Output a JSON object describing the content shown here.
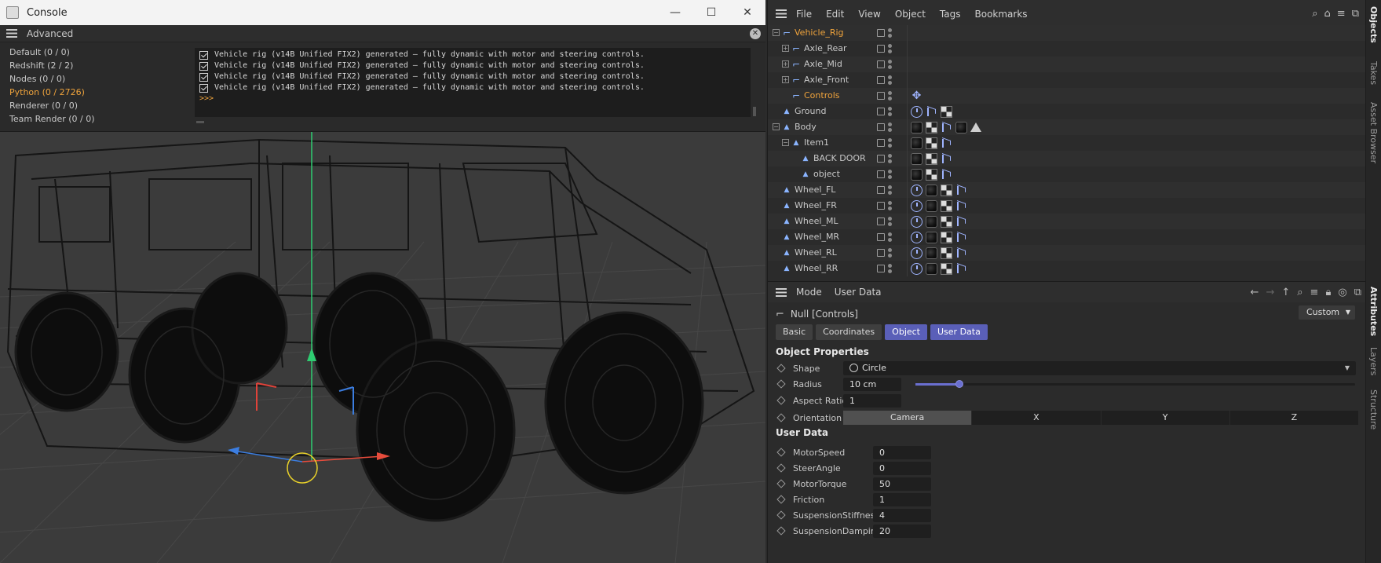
{
  "console": {
    "title": "Console",
    "window_controls": [
      "—",
      "☐",
      "✕"
    ],
    "subheader": "Advanced",
    "categories": [
      {
        "label": "Default (0 / 0)",
        "active": false
      },
      {
        "label": "Redshift (2 / 2)",
        "active": false
      },
      {
        "label": "Nodes (0 / 0)",
        "active": false
      },
      {
        "label": "Python (0 / 2726)",
        "active": true
      },
      {
        "label": "Renderer (0 / 0)",
        "active": false
      },
      {
        "label": "Team Render  (0 / 0)",
        "active": false
      }
    ],
    "lines": [
      "Vehicle rig (v14B Unified FIX2) generated — fully dynamic with motor and steering controls.",
      "Vehicle rig (v14B Unified FIX2) generated — fully dynamic with motor and steering controls.",
      "Vehicle rig (v14B Unified FIX2) generated — fully dynamic with motor and steering controls.",
      "Vehicle rig (v14B Unified FIX2) generated — fully dynamic with motor and steering controls."
    ],
    "prompt": ">>>"
  },
  "menu": {
    "items": [
      "File",
      "Edit",
      "View",
      "Object",
      "Tags",
      "Bookmarks"
    ]
  },
  "objects": [
    {
      "name": "Vehicle_Rig",
      "level": 0,
      "expander": "−",
      "icon": "null",
      "selected": true,
      "tags": []
    },
    {
      "name": "Axle_Rear",
      "level": 1,
      "expander": "+",
      "icon": "null",
      "selected": false,
      "tags": []
    },
    {
      "name": "Axle_Mid",
      "level": 1,
      "expander": "+",
      "icon": "null",
      "selected": false,
      "tags": []
    },
    {
      "name": "Axle_Front",
      "level": 1,
      "expander": "+",
      "icon": "null",
      "selected": false,
      "tags": []
    },
    {
      "name": "Controls",
      "level": 1,
      "expander": "",
      "icon": "null",
      "selected": true,
      "tags": [
        "ctl"
      ]
    },
    {
      "name": "Ground",
      "level": 0,
      "expander": "",
      "icon": "poly",
      "selected": false,
      "tags": [
        "rot",
        "uv",
        "chk"
      ]
    },
    {
      "name": "Body",
      "level": 0,
      "expander": "−",
      "icon": "poly",
      "selected": false,
      "tags": [
        "mat",
        "chk",
        "uv",
        "mat",
        "tri"
      ]
    },
    {
      "name": "Item1",
      "level": 1,
      "expander": "−",
      "icon": "poly",
      "selected": false,
      "tags": [
        "mat",
        "chk",
        "uv"
      ]
    },
    {
      "name": "BACK DOOR",
      "level": 2,
      "expander": "",
      "icon": "poly",
      "selected": false,
      "tags": [
        "mat",
        "chk",
        "uv"
      ]
    },
    {
      "name": "object",
      "level": 2,
      "expander": "",
      "icon": "poly",
      "selected": false,
      "tags": [
        "mat",
        "chk",
        "uv"
      ]
    },
    {
      "name": "Wheel_FL",
      "level": 0,
      "expander": "",
      "icon": "poly",
      "selected": false,
      "tags": [
        "rot",
        "mat",
        "chk",
        "uv"
      ]
    },
    {
      "name": "Wheel_FR",
      "level": 0,
      "expander": "",
      "icon": "poly",
      "selected": false,
      "tags": [
        "rot",
        "mat",
        "chk",
        "uv"
      ]
    },
    {
      "name": "Wheel_ML",
      "level": 0,
      "expander": "",
      "icon": "poly",
      "selected": false,
      "tags": [
        "rot",
        "mat",
        "chk",
        "uv"
      ]
    },
    {
      "name": "Wheel_MR",
      "level": 0,
      "expander": "",
      "icon": "poly",
      "selected": false,
      "tags": [
        "rot",
        "mat",
        "chk",
        "uv"
      ]
    },
    {
      "name": "Wheel_RL",
      "level": 0,
      "expander": "",
      "icon": "poly",
      "selected": false,
      "tags": [
        "rot",
        "mat",
        "chk",
        "uv"
      ]
    },
    {
      "name": "Wheel_RR",
      "level": 0,
      "expander": "",
      "icon": "poly",
      "selected": false,
      "tags": [
        "rot",
        "mat",
        "chk",
        "uv"
      ]
    }
  ],
  "attributes": {
    "header": {
      "mode": "Mode",
      "userdata": "User Data"
    },
    "object_title": "Null [Controls]",
    "layout_preset": "Custom",
    "tabs": [
      {
        "label": "Basic",
        "active": false
      },
      {
        "label": "Coordinates",
        "active": false
      },
      {
        "label": "Object",
        "active": true
      },
      {
        "label": "User Data",
        "active": true
      }
    ],
    "object_properties": {
      "title": "Object Properties",
      "shape_label": "Shape",
      "shape_value": "Circle",
      "radius_label": "Radius",
      "radius_value": "10 cm",
      "radius_slider_fraction": 0.1,
      "aspect_label": "Aspect Ratio",
      "aspect_value": "1",
      "orientation_label": "Orientation",
      "orientation_options": [
        "Camera",
        "X",
        "Y",
        "Z"
      ],
      "orientation_selected": 0
    },
    "user_data": {
      "title": "User Data",
      "fields": [
        {
          "label": "MotorSpeed",
          "value": "0"
        },
        {
          "label": "SteerAngle",
          "value": "0"
        },
        {
          "label": "MotorTorque",
          "value": "50"
        },
        {
          "label": "Friction",
          "value": "1"
        },
        {
          "label": "SuspensionStiffness",
          "value": "4"
        },
        {
          "label": "SuspensionDamping",
          "value": "20"
        }
      ]
    }
  },
  "side_tabs": [
    {
      "label": "Objects",
      "active": true
    },
    {
      "label": "Takes",
      "active": false
    },
    {
      "label": "Asset Browser",
      "active": false
    },
    {
      "label": "Attributes",
      "active": true
    },
    {
      "label": "Layers",
      "active": false
    },
    {
      "label": "Structure",
      "active": false
    }
  ],
  "colors": {
    "accent_orange": "#f0a43c",
    "tab_active": "#5a5fb8",
    "axis_y": "#2ecc71",
    "axis_x": "#e74c3c",
    "axis_z": "#3b7de0"
  }
}
